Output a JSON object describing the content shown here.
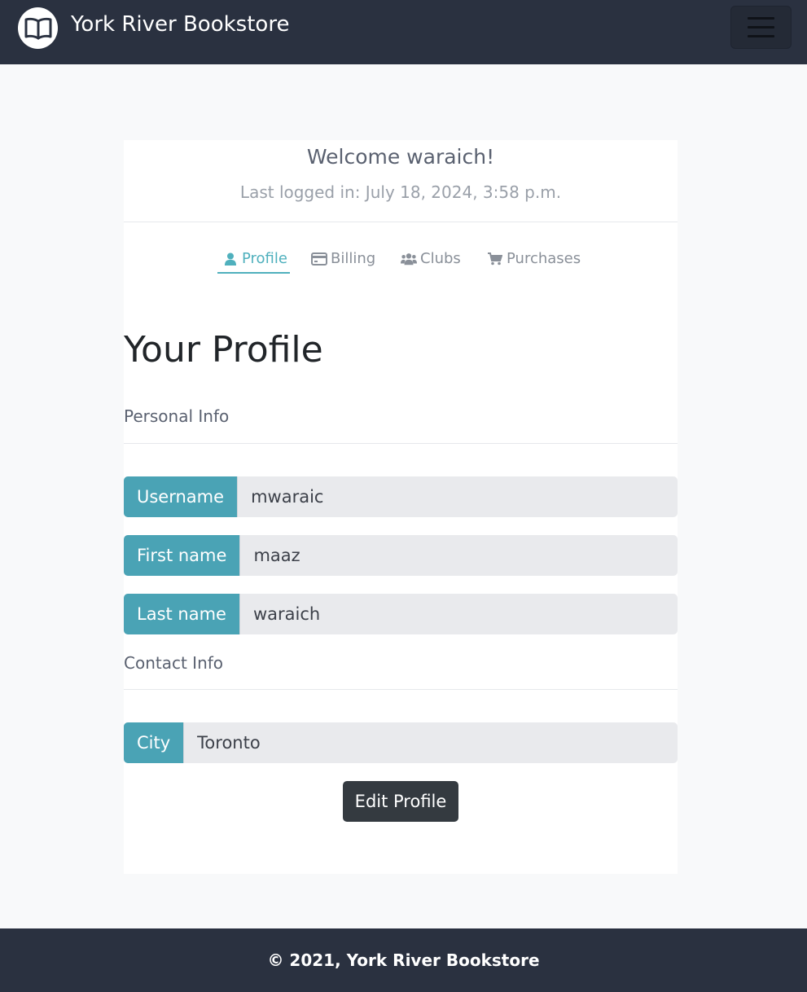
{
  "navbar": {
    "brand": "York River Bookstore",
    "logo_icon": "open-book-icon",
    "menu_icon": "hamburger-icon"
  },
  "header": {
    "welcome": "Welcome waraich!",
    "last_logged": "Last logged in: July 18, 2024, 3:58 p.m."
  },
  "tabs": [
    {
      "label": "Profile",
      "icon": "user-icon",
      "active": true
    },
    {
      "label": "Billing",
      "icon": "credit-card-icon",
      "active": false
    },
    {
      "label": "Clubs",
      "icon": "users-icon",
      "active": false
    },
    {
      "label": "Purchases",
      "icon": "cart-icon",
      "active": false
    }
  ],
  "profile": {
    "title": "Your Profile",
    "personal_info_label": "Personal Info",
    "contact_info_label": "Contact Info",
    "fields": {
      "username": {
        "label": "Username",
        "value": "mwaraic"
      },
      "first_name": {
        "label": "First name",
        "value": "maaz"
      },
      "last_name": {
        "label": "Last name",
        "value": "waraich"
      },
      "city": {
        "label": "City",
        "value": "Toronto"
      }
    },
    "edit_button": "Edit Profile"
  },
  "footer": {
    "text": "© 2021, York River Bookstore"
  },
  "colors": {
    "navbar_bg": "#2a3140",
    "accent": "#4fb0bd",
    "field_label_bg": "#4aa3b5",
    "button_bg": "#343a40"
  }
}
